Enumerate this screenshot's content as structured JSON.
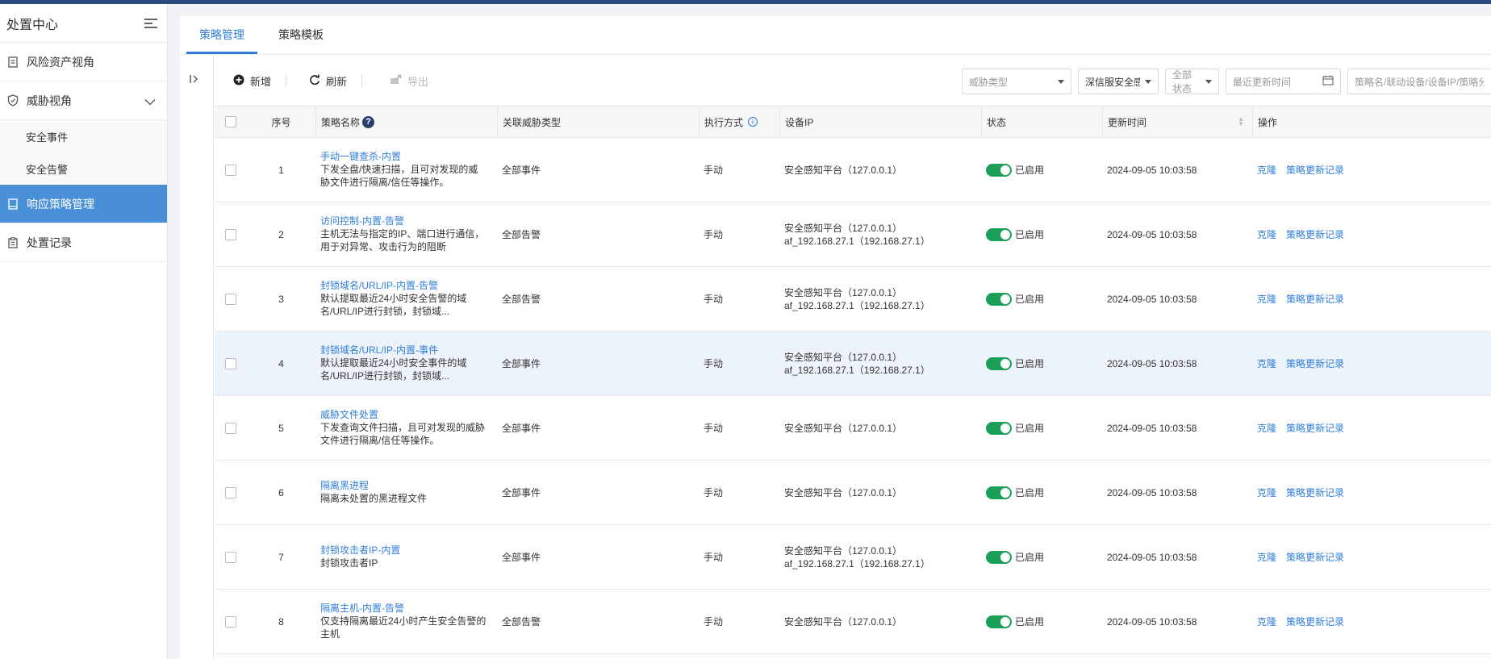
{
  "sidebar": {
    "title": "处置中心",
    "items": [
      {
        "label": "风险资产视角"
      },
      {
        "label": "威胁视角"
      },
      {
        "label": "响应策略管理"
      },
      {
        "label": "处置记录"
      }
    ],
    "subitems": [
      {
        "label": "安全事件"
      },
      {
        "label": "安全告警"
      }
    ]
  },
  "tabs": [
    {
      "label": "策略管理"
    },
    {
      "label": "策略模板"
    }
  ],
  "toolbar": {
    "add_label": "新增",
    "refresh_label": "刷新",
    "export_label": "导出"
  },
  "filters": {
    "threat_type_placeholder": "威胁类型",
    "device_value": "深信服安全感知",
    "status_value": "全部状态",
    "update_time_placeholder": "最近更新时间",
    "search_placeholder": "策略名/联动设备/设备IP/策略分类"
  },
  "table": {
    "headers": {
      "index": "序号",
      "name": "策略名称",
      "threat_type": "关联威胁类型",
      "exec": "执行方式",
      "device_ip": "设备IP",
      "status": "状态",
      "updated": "更新时间",
      "ops": "操作"
    },
    "ops": {
      "clone": "克隆",
      "history": "策略更新记录"
    },
    "rows": [
      {
        "index": "1",
        "name": "手动一键查杀-内置",
        "desc1": "下发全盘/快速扫描，且可对发现的威",
        "desc2": "胁文件进行隔离/信任等操作。",
        "threat": "全部事件",
        "exec": "手动",
        "ip1": "安全感知平台（127.0.0.1）",
        "ip2": "",
        "status": "已启用",
        "updated": "2024-09-05 10:03:58"
      },
      {
        "index": "2",
        "name": "访问控制-内置-告警",
        "desc1": "主机无法与指定的IP、端口进行通信，",
        "desc2": "用于对异常、攻击行为的阻断",
        "threat": "全部告警",
        "exec": "手动",
        "ip1": "安全感知平台（127.0.0.1）",
        "ip2": "af_192.168.27.1（192.168.27.1）",
        "status": "已启用",
        "updated": "2024-09-05 10:03:58"
      },
      {
        "index": "3",
        "name": "封锁域名/URL/IP-内置-告警",
        "desc1": "默认提取最近24小时安全告警的域",
        "desc2": "名/URL/IP进行封锁，封锁域...",
        "threat": "全部告警",
        "exec": "手动",
        "ip1": "安全感知平台（127.0.0.1）",
        "ip2": "af_192.168.27.1（192.168.27.1）",
        "status": "已启用",
        "updated": "2024-09-05 10:03:58"
      },
      {
        "index": "4",
        "name": "封锁域名/URL/IP-内置-事件",
        "desc1": "默认提取最近24小时安全事件的域",
        "desc2": "名/URL/IP进行封锁，封锁域...",
        "threat": "全部事件",
        "exec": "手动",
        "ip1": "安全感知平台（127.0.0.1）",
        "ip2": "af_192.168.27.1（192.168.27.1）",
        "status": "已启用",
        "updated": "2024-09-05 10:03:58"
      },
      {
        "index": "5",
        "name": "威胁文件处置",
        "desc1": "下发查询文件扫描，且可对发现的威胁",
        "desc2": "文件进行隔离/信任等操作。",
        "threat": "全部事件",
        "exec": "手动",
        "ip1": "安全感知平台（127.0.0.1）",
        "ip2": "",
        "status": "已启用",
        "updated": "2024-09-05 10:03:58"
      },
      {
        "index": "6",
        "name": "隔离黑进程",
        "desc1": "隔离未处置的黑进程文件",
        "desc2": "",
        "threat": "全部事件",
        "exec": "手动",
        "ip1": "安全感知平台（127.0.0.1）",
        "ip2": "",
        "status": "已启用",
        "updated": "2024-09-05 10:03:58"
      },
      {
        "index": "7",
        "name": "封锁攻击者IP-内置",
        "desc1": "封锁攻击者IP",
        "desc2": "",
        "threat": "全部事件",
        "exec": "手动",
        "ip1": "安全感知平台（127.0.0.1）",
        "ip2": "af_192.168.27.1（192.168.27.1）",
        "status": "已启用",
        "updated": "2024-09-05 10:03:58"
      },
      {
        "index": "8",
        "name": "隔离主机-内置-告警",
        "desc1": "仅支持隔离最近24小时产生安全告警的",
        "desc2": "主机",
        "threat": "全部告警",
        "exec": "手动",
        "ip1": "安全感知平台（127.0.0.1）",
        "ip2": "",
        "status": "已启用",
        "updated": "2024-09-05 10:03:58"
      }
    ]
  },
  "colors": {
    "accent": "#2f7ed8",
    "active_nav_bg": "#4a90d9",
    "toggle_on": "#18a058"
  }
}
